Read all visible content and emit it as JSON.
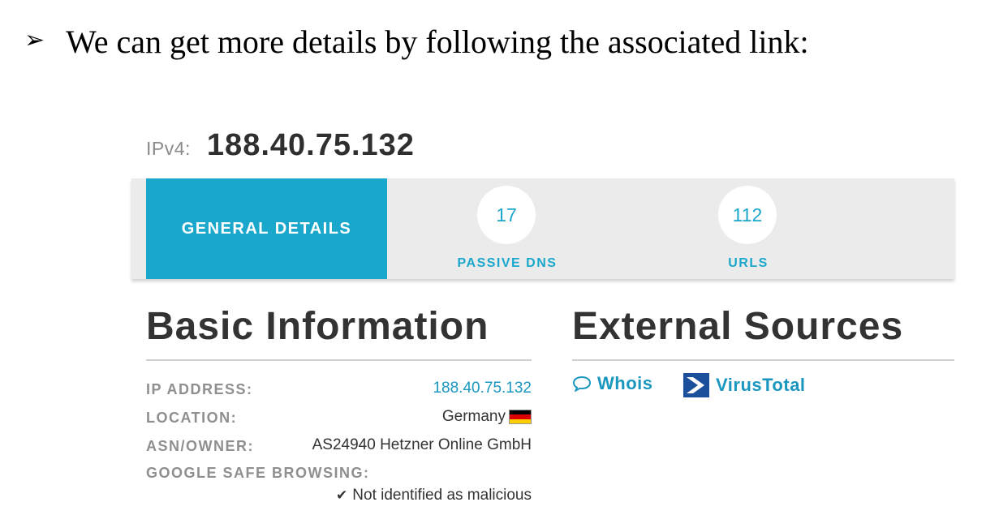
{
  "bullet": {
    "arrow": "➢",
    "text": "We can get more details by following the associated link:"
  },
  "ip": {
    "label": "IPv4:",
    "value": "188.40.75.132"
  },
  "tabs": {
    "general_label": "GENERAL DETAILS",
    "passive_dns": {
      "count": "17",
      "label": "PASSIVE DNS"
    },
    "urls": {
      "count": "112",
      "label": "URLS"
    }
  },
  "basic": {
    "title": "Basic Information",
    "fields": [
      {
        "label": "IP ADDRESS:",
        "value": "188.40.75.132"
      },
      {
        "label": "LOCATION:",
        "value": "Germany"
      },
      {
        "label": "ASN/OWNER:",
        "value": "AS24940 Hetzner Online GmbH"
      },
      {
        "label": "GOOGLE SAFE BROWSING:",
        "value": "Not identified as malicious"
      }
    ]
  },
  "external": {
    "title": "External Sources",
    "links": [
      {
        "label": "Whois",
        "icon": "speech-bubble-icon"
      },
      {
        "label": "VirusTotal",
        "icon": "virustotal-logo-icon"
      }
    ]
  },
  "colors": {
    "accent": "#1aa7cc",
    "link": "#1a97bf",
    "tabbar": "#ebebeb"
  }
}
